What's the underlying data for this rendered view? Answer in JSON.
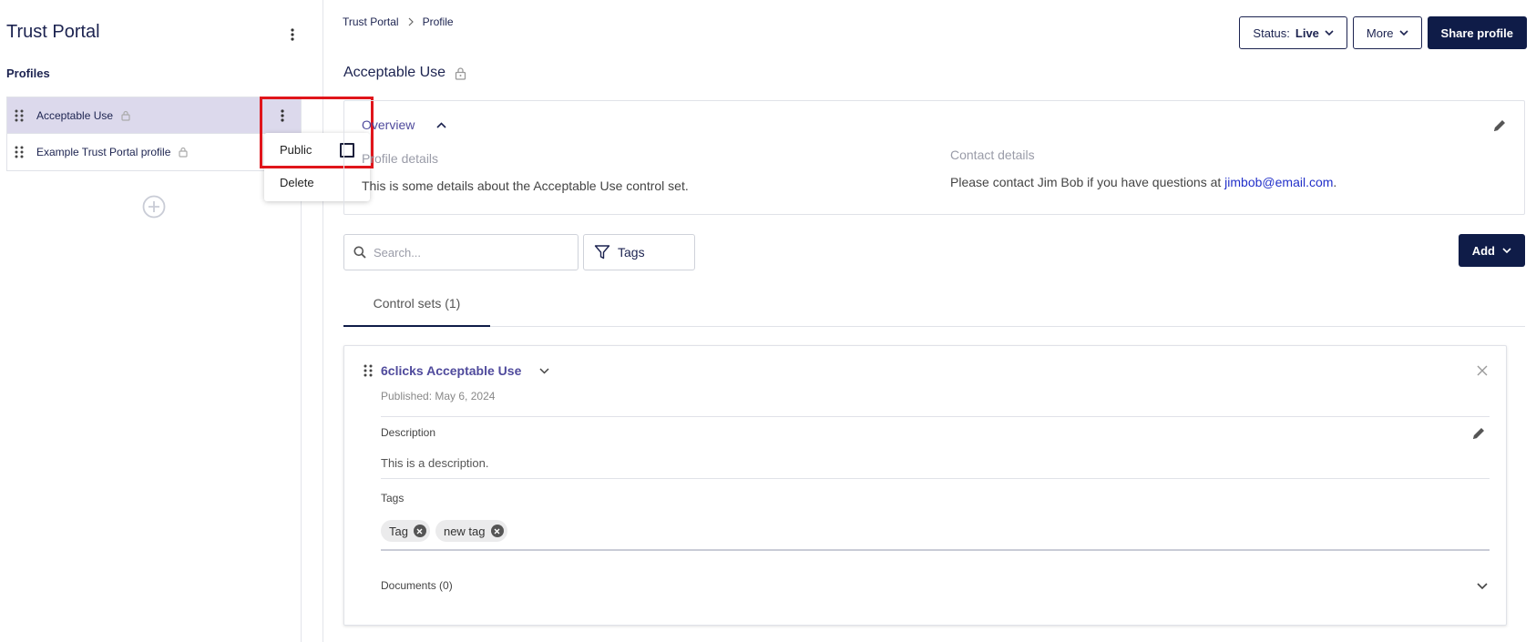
{
  "sidebar": {
    "title": "Trust Portal",
    "profiles_label": "Profiles",
    "items": [
      {
        "label": "Acceptable Use",
        "active": true,
        "locked": true
      },
      {
        "label": "Example Trust Portal profile",
        "active": false,
        "locked": true
      }
    ]
  },
  "context_menu": {
    "public_label": "Public",
    "public_checked": false,
    "delete_label": "Delete"
  },
  "breadcrumb": {
    "items": [
      "Trust Portal",
      "Profile"
    ]
  },
  "toolbar": {
    "status_label": "Status:",
    "status_value": "Live",
    "more_label": "More",
    "share_label": "Share profile"
  },
  "page": {
    "title": "Acceptable Use"
  },
  "overview": {
    "title": "Overview",
    "profile_details_label": "Profile details",
    "profile_details_text": "This is some details about the Acceptable Use control set.",
    "contact_details_label": "Contact details",
    "contact_text_prefix": "Please contact Jim Bob if you have questions at ",
    "contact_email": "jimbob@email.com",
    "contact_text_suffix": "."
  },
  "filters": {
    "search_placeholder": "Search...",
    "tags_label": "Tags",
    "add_label": "Add"
  },
  "tabs": [
    {
      "label": "Control sets (1)",
      "active": true
    }
  ],
  "control_set": {
    "title": "6clicks Acceptable Use",
    "published": "Published: May 6, 2024",
    "description_label": "Description",
    "description_text": "This is a description.",
    "tags_label": "Tags",
    "tags": [
      "Tag",
      "new tag"
    ],
    "documents_label": "Documents (0)"
  },
  "colors": {
    "primary": "#0f1c48",
    "accent": "#4f4a9c",
    "active_item_bg": "#dcd9ec",
    "highlight": "#e0151b",
    "link": "#2230c9"
  }
}
